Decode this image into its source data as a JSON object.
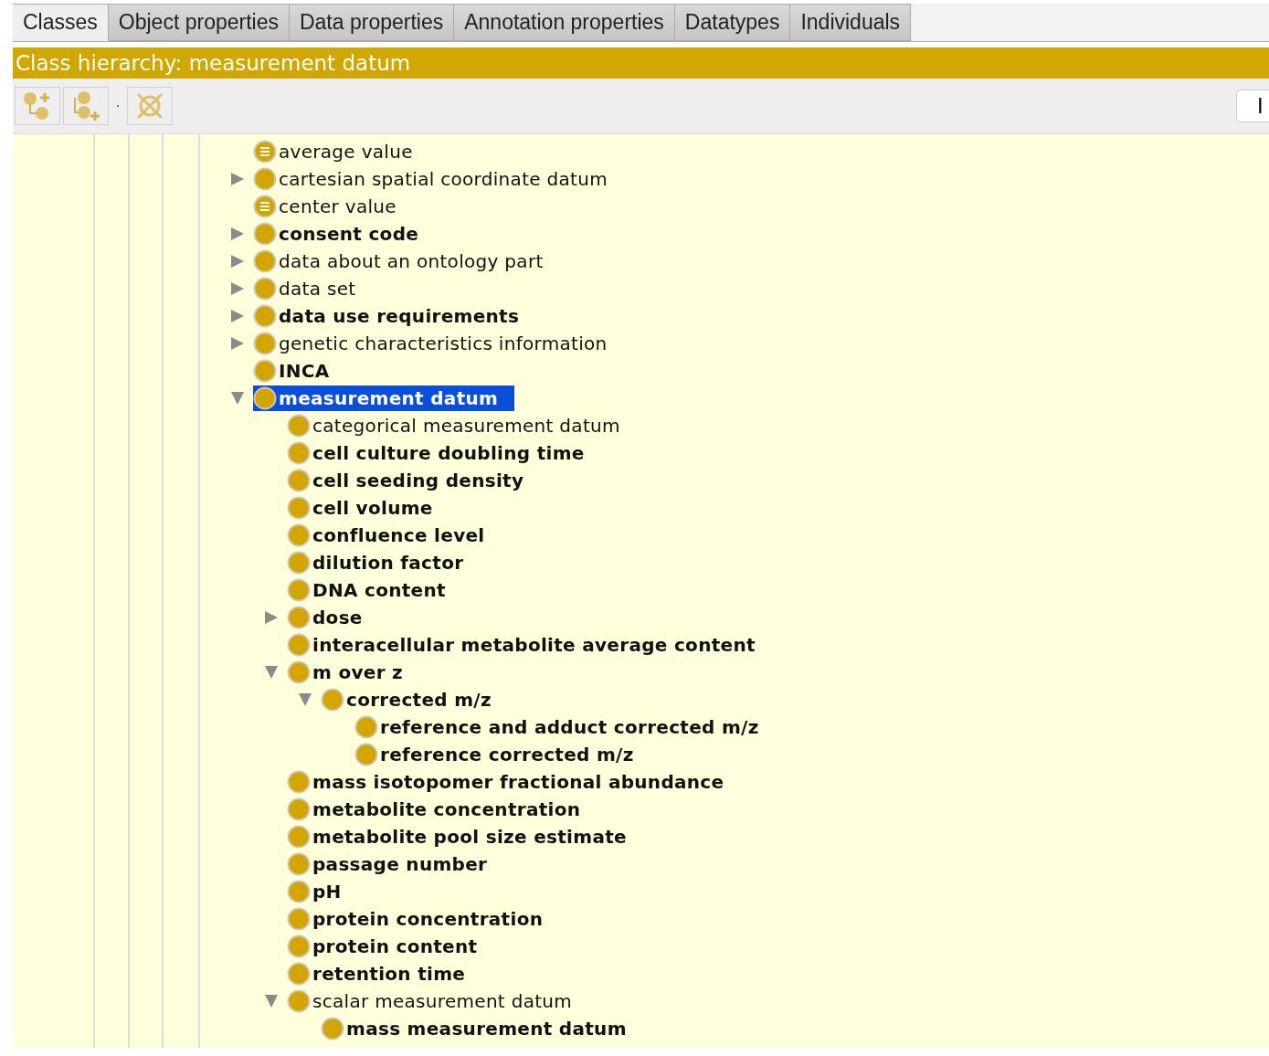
{
  "tabs": [
    {
      "label": "Classes",
      "selected": true
    },
    {
      "label": "Object properties",
      "selected": false
    },
    {
      "label": "Data properties",
      "selected": false
    },
    {
      "label": "Annotation properties",
      "selected": false
    },
    {
      "label": "Datatypes",
      "selected": false
    },
    {
      "label": "Individuals",
      "selected": false
    }
  ],
  "header": {
    "title": "Class hierarchy: measurement datum"
  },
  "toolbar": {
    "right_button": "I"
  },
  "tree": [
    {
      "label": "average value",
      "kind": "defined",
      "bold": false,
      "has_children": false,
      "selected": false
    },
    {
      "label": "cartesian spatial coordinate datum",
      "kind": "class",
      "bold": false,
      "has_children": true,
      "expanded": false,
      "selected": false
    },
    {
      "label": "center value",
      "kind": "defined",
      "bold": false,
      "has_children": false,
      "selected": false
    },
    {
      "label": "consent code",
      "kind": "class",
      "bold": true,
      "has_children": true,
      "expanded": false,
      "selected": false
    },
    {
      "label": "data about an ontology part",
      "kind": "class",
      "bold": false,
      "has_children": true,
      "expanded": false,
      "selected": false
    },
    {
      "label": "data set",
      "kind": "class",
      "bold": false,
      "has_children": true,
      "expanded": false,
      "selected": false
    },
    {
      "label": "data use requirements",
      "kind": "class",
      "bold": true,
      "has_children": true,
      "expanded": false,
      "selected": false
    },
    {
      "label": "genetic characteristics information",
      "kind": "class",
      "bold": false,
      "has_children": true,
      "expanded": false,
      "selected": false
    },
    {
      "label": "INCA",
      "kind": "class",
      "bold": true,
      "has_children": false,
      "selected": false
    },
    {
      "label": "measurement datum",
      "kind": "class",
      "bold": true,
      "has_children": true,
      "expanded": true,
      "selected": true,
      "children": [
        {
          "label": "categorical measurement datum",
          "kind": "class",
          "bold": false,
          "has_children": false,
          "selected": false
        },
        {
          "label": "cell culture doubling time",
          "kind": "class",
          "bold": true,
          "has_children": false,
          "selected": false
        },
        {
          "label": "cell seeding density",
          "kind": "class",
          "bold": true,
          "has_children": false,
          "selected": false
        },
        {
          "label": "cell volume",
          "kind": "class",
          "bold": true,
          "has_children": false,
          "selected": false
        },
        {
          "label": "confluence level",
          "kind": "class",
          "bold": true,
          "has_children": false,
          "selected": false
        },
        {
          "label": "dilution factor",
          "kind": "class",
          "bold": true,
          "has_children": false,
          "selected": false
        },
        {
          "label": "DNA content",
          "kind": "class",
          "bold": true,
          "has_children": false,
          "selected": false
        },
        {
          "label": "dose",
          "kind": "class",
          "bold": true,
          "has_children": true,
          "expanded": false,
          "selected": false
        },
        {
          "label": "interacellular metabolite average content",
          "kind": "class",
          "bold": true,
          "has_children": false,
          "selected": false
        },
        {
          "label": "m over z",
          "kind": "class",
          "bold": true,
          "has_children": true,
          "expanded": true,
          "selected": false,
          "children": [
            {
              "label": "corrected m/z",
              "kind": "class",
              "bold": true,
              "has_children": true,
              "expanded": true,
              "selected": false,
              "children": [
                {
                  "label": "reference and adduct corrected m/z",
                  "kind": "class",
                  "bold": true,
                  "has_children": false,
                  "selected": false
                },
                {
                  "label": "reference corrected m/z",
                  "kind": "class",
                  "bold": true,
                  "has_children": false,
                  "selected": false
                }
              ]
            }
          ]
        },
        {
          "label": "mass isotopomer fractional abundance",
          "kind": "class",
          "bold": true,
          "has_children": false,
          "selected": false
        },
        {
          "label": "metabolite concentration",
          "kind": "class",
          "bold": true,
          "has_children": false,
          "selected": false
        },
        {
          "label": "metabolite pool size estimate",
          "kind": "class",
          "bold": true,
          "has_children": false,
          "selected": false
        },
        {
          "label": "passage number",
          "kind": "class",
          "bold": true,
          "has_children": false,
          "selected": false
        },
        {
          "label": "pH",
          "kind": "class",
          "bold": true,
          "has_children": false,
          "selected": false
        },
        {
          "label": "protein concentration",
          "kind": "class",
          "bold": true,
          "has_children": false,
          "selected": false
        },
        {
          "label": "protein content",
          "kind": "class",
          "bold": true,
          "has_children": false,
          "selected": false
        },
        {
          "label": "retention time",
          "kind": "class",
          "bold": true,
          "has_children": false,
          "selected": false
        },
        {
          "label": "scalar measurement datum",
          "kind": "class",
          "bold": false,
          "has_children": true,
          "expanded": true,
          "selected": false,
          "children": [
            {
              "label": "mass measurement datum",
              "kind": "class",
              "bold": true,
              "has_children": false,
              "selected": false
            }
          ]
        }
      ]
    }
  ]
}
